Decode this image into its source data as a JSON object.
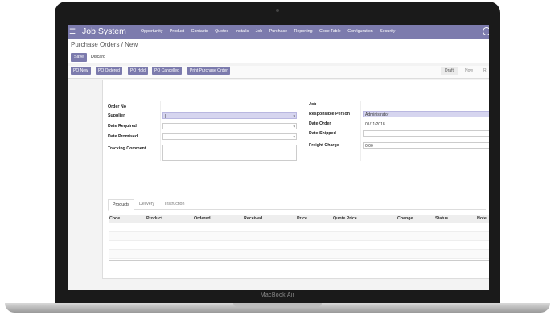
{
  "device": {
    "model_label": "MacBook Air"
  },
  "navbar": {
    "brand": "Job System",
    "items": [
      "Opportunity",
      "Product",
      "Contacts",
      "Quotes",
      "Installs",
      "Job",
      "Purchase",
      "Reporting",
      "Code Table",
      "Configuration",
      "Security"
    ]
  },
  "control_panel": {
    "breadcrumb": "Purchase Orders / New",
    "save_label": "Save",
    "discard_label": "Discard"
  },
  "header": {
    "buttons": [
      "PO New",
      "PO Ordered",
      "PO Hold",
      "PO Cancelled",
      "Print Purchase Order"
    ],
    "statuses": [
      "Draft",
      "Now",
      "R"
    ]
  },
  "form": {
    "left": {
      "order_no_label": "Order No",
      "supplier_label": "Supplier",
      "supplier_value": "|",
      "date_required_label": "Date Required",
      "date_promised_label": "Date Promised",
      "tracking_comment_label": "Tracking Comment"
    },
    "right": {
      "job_label": "Job",
      "responsible_label": "Responsible Person",
      "responsible_value": "Administrator",
      "date_order_label": "Date Order",
      "date_order_value": "01/11/2018",
      "date_shipped_label": "Date Shipped",
      "freight_label": "Freight Charge",
      "freight_value": "0.00"
    }
  },
  "tabs": [
    "Products",
    "Delivery",
    "Instruction"
  ],
  "table": {
    "columns": [
      "Code",
      "Product",
      "Ordered",
      "Received",
      "Price",
      "Quote Price",
      "Change",
      "Status",
      "Note"
    ]
  },
  "colors": {
    "accent": "#7c7bad",
    "highlight": "#d6d5ef"
  }
}
